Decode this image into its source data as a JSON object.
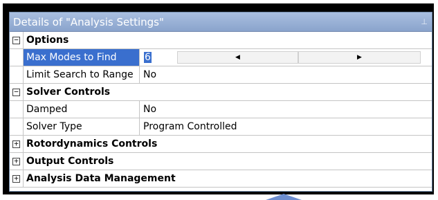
{
  "panel": {
    "title": "Details of \"Analysis Settings\"",
    "pin_icon": "pin-icon"
  },
  "groups": {
    "options": {
      "label": "Options",
      "expander": "⊟",
      "rows": [
        {
          "name": "Max Modes to Find",
          "value": "6"
        },
        {
          "name": "Limit Search to Range",
          "value": "No"
        }
      ]
    },
    "solver": {
      "label": "Solver Controls",
      "expander": "⊟",
      "rows": [
        {
          "name": "Damped",
          "value": "No"
        },
        {
          "name": "Solver Type",
          "value": "Program Controlled"
        }
      ]
    },
    "rotordynamics": {
      "label": "Rotordynamics Controls",
      "expander": "+"
    },
    "output": {
      "label": "Output Controls",
      "expander": "+"
    },
    "analysis_data": {
      "label": "Analysis Data Management",
      "expander": "+"
    }
  },
  "editor": {
    "spin_left": "◀",
    "spin_right": "▶"
  },
  "colors": {
    "titlebar": "#9ab2d8",
    "selection": "#3a6fce",
    "frame": "#000000",
    "arrow": "#6c8ed0"
  }
}
